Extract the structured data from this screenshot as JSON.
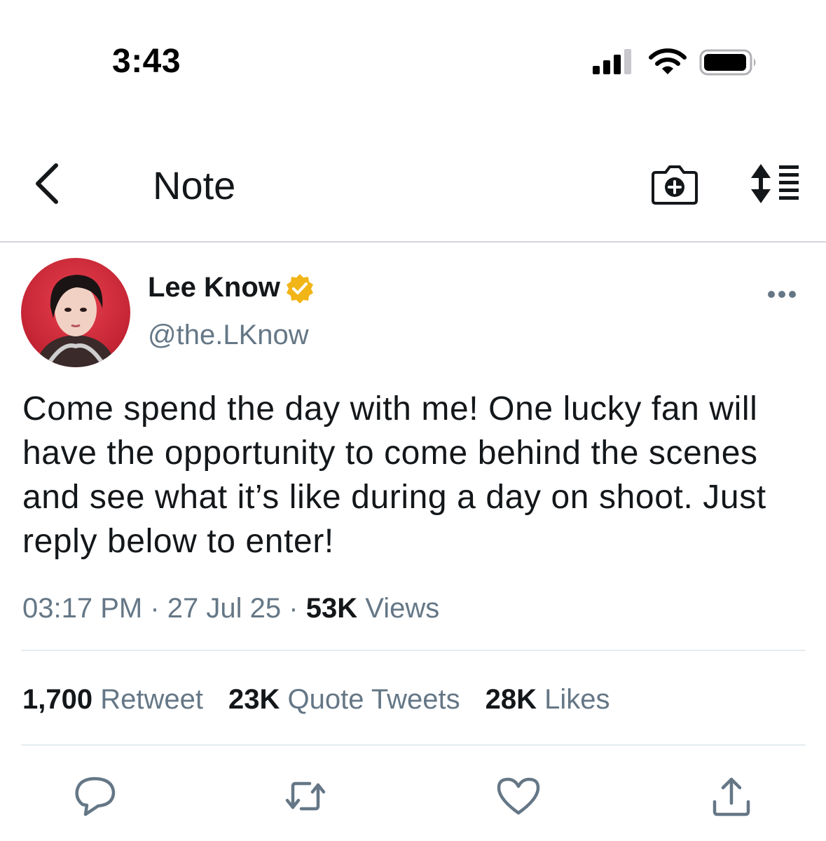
{
  "status_bar": {
    "time": "3:43",
    "icons": [
      "cellular-signal-icon",
      "wifi-icon",
      "battery-icon"
    ]
  },
  "nav": {
    "back_icon": "chevron-left-icon",
    "title": "Note",
    "actions": [
      "camera-plus-icon",
      "sort-list-icon"
    ]
  },
  "tweet": {
    "author": {
      "name": "Lee Know",
      "handle": "@the.LKnow",
      "verified_icon": "verified-badge-icon",
      "verified_color": "#F2B517"
    },
    "more_icon": "ellipsis-icon",
    "text": "Come spend the day with me! One lucky fan will have the opportunity to come behind the scenes and see what it’s like during a day on shoot. Just reply below to enter!",
    "time": "03:17 PM",
    "separator": "·",
    "date": "27 Jul 25",
    "views_count": "53K",
    "views_label": "Views",
    "stats": {
      "retweets": {
        "count": "1,700",
        "label": "Retweet"
      },
      "quotes": {
        "count": "23K",
        "label": "Quote Tweets"
      },
      "likes": {
        "count": "28K",
        "label": "Likes"
      }
    },
    "actions": [
      "reply-icon",
      "retweet-icon",
      "like-heart-icon",
      "share-icon"
    ]
  },
  "colors": {
    "text_primary": "#14171A",
    "text_secondary": "#657786",
    "icon_gray": "#657786",
    "divider": "#E6ECF0",
    "avatar_bg": "#D92B3A"
  }
}
